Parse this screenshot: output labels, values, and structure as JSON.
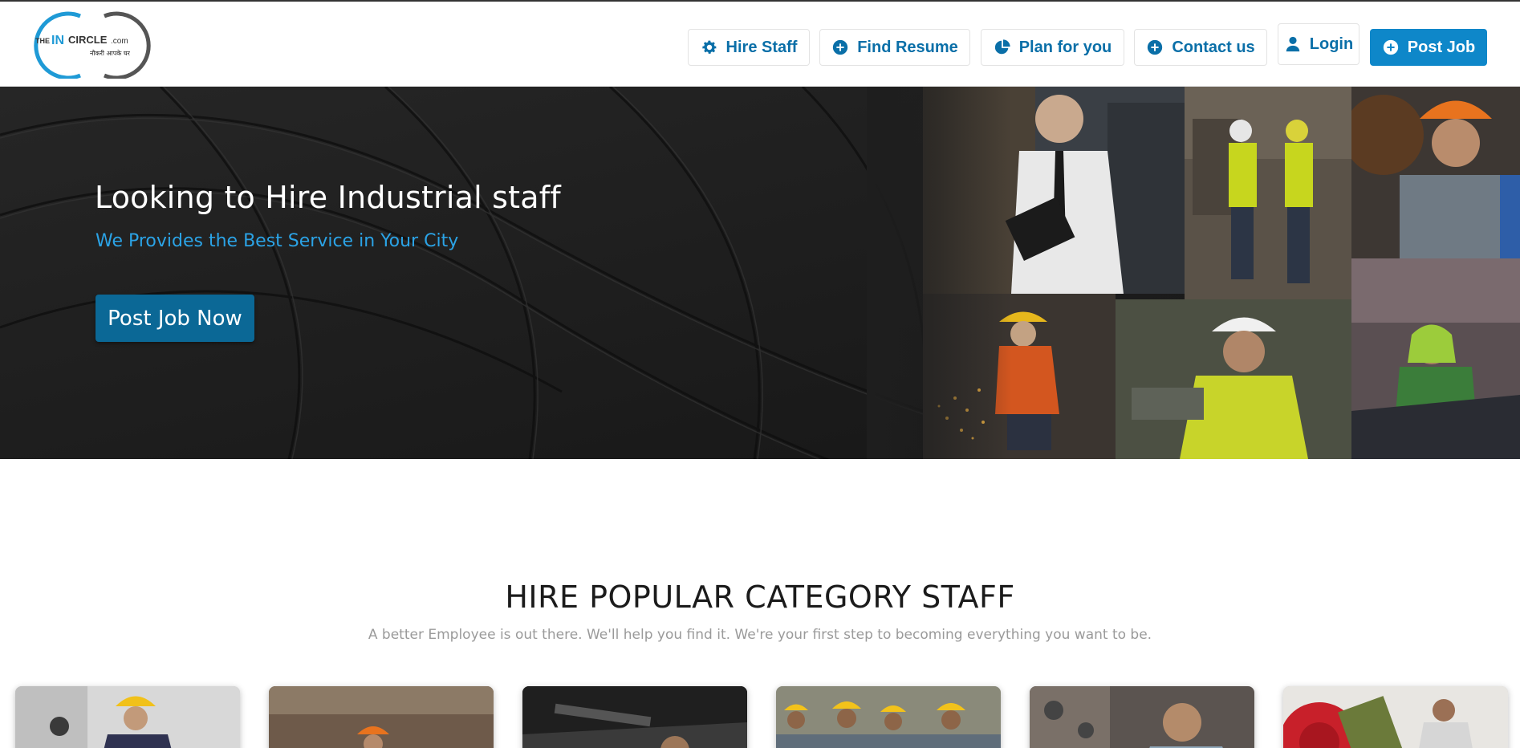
{
  "header": {
    "logo": {
      "brand_prefix": "THE",
      "brand_in": "IN",
      "brand_rest": "CIRCLE",
      "brand_domain": ".com",
      "tagline": "नौकरी आपके घर"
    },
    "nav": [
      {
        "label": "Hire Staff",
        "icon": "gear-icon"
      },
      {
        "label": "Find Resume",
        "icon": "plus-circle-icon"
      },
      {
        "label": "Plan for you",
        "icon": "pie-chart-icon"
      },
      {
        "label": "Contact us",
        "icon": "plus-circle-icon"
      },
      {
        "label": "Login",
        "icon": "user-icon"
      },
      {
        "label": "Post Job",
        "icon": "plus-circle-icon"
      }
    ]
  },
  "hero": {
    "title": "Looking to Hire Industrial staff",
    "subtitle": "We Provides the Best Service in Your City",
    "cta_label": "Post Job Now"
  },
  "categories_section": {
    "title": "HIRE POPULAR CATEGORY STAFF",
    "subtitle": "A better Employee is out there. We'll help you find it. We're your first step to becoming everything you want to be."
  },
  "colors": {
    "brand_blue": "#0e87c9",
    "link_blue": "#0a6fa8",
    "hero_subtitle": "#2ba3e6",
    "hero_button": "#0b6896",
    "hero_bg": "#1d1d1d"
  }
}
